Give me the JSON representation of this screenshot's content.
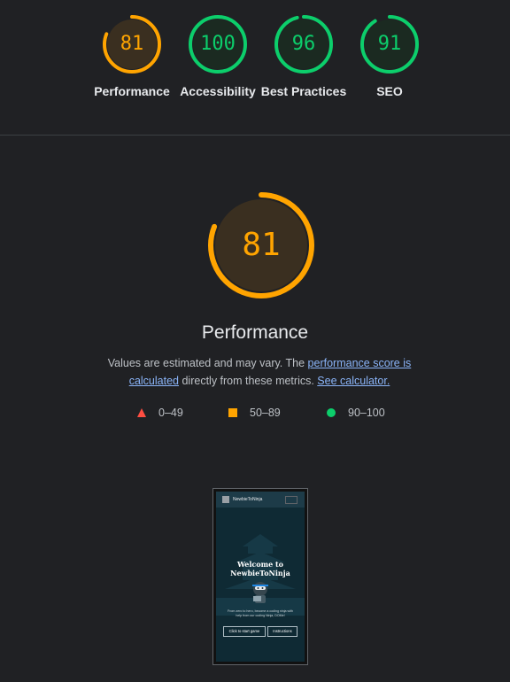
{
  "colors": {
    "background": "#202124",
    "average": "#ffa400",
    "pass": "#0cce6b",
    "fail": "#ff4e42",
    "link": "#8ab4f8"
  },
  "categories": [
    {
      "label": "Performance",
      "score": "81",
      "value": 0.81,
      "rating": "average"
    },
    {
      "label": "Accessibility",
      "score": "100",
      "value": 1.0,
      "rating": "pass"
    },
    {
      "label": "Best Practices",
      "score": "96",
      "value": 0.96,
      "rating": "pass"
    },
    {
      "label": "SEO",
      "score": "91",
      "value": 0.91,
      "rating": "pass"
    }
  ],
  "performance": {
    "score": "81",
    "value": 0.81,
    "title": "Performance",
    "description_prefix": "Values are estimated and may vary. The ",
    "score_link": "performance score is calculated",
    "description_middle": " directly from these metrics. ",
    "calculator_link": "See calculator."
  },
  "legend": [
    {
      "icon": "triangle-icon",
      "label": "0–49"
    },
    {
      "icon": "square-icon",
      "label": "50–89"
    },
    {
      "icon": "circle-icon",
      "label": "90–100"
    }
  ],
  "screenshot": {
    "brand": "NewbieToNinja",
    "heading": "Welcome to NewbieToNinja",
    "tagline": "From zero to hero, become a coding ninja with help from our coding Ninja, DOMe!",
    "start_button": "Click to start game",
    "instructions_button": "Instructions"
  }
}
